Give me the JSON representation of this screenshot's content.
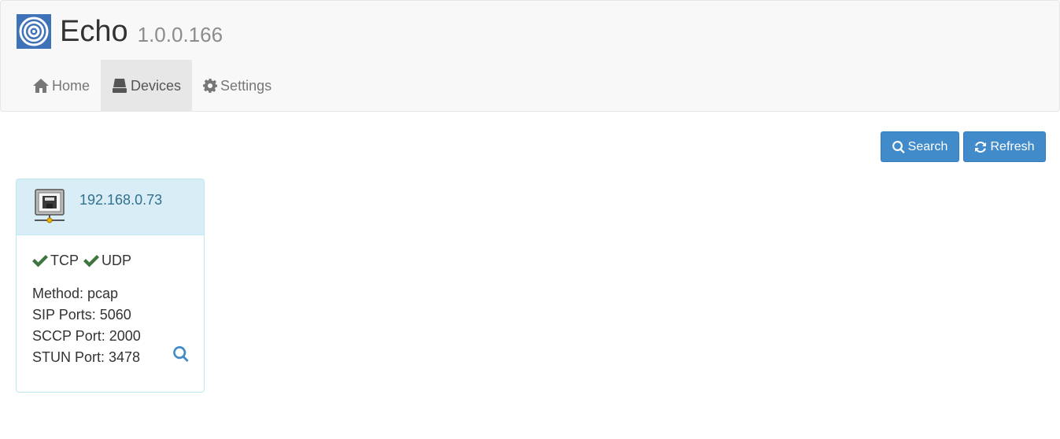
{
  "app": {
    "title": "Echo",
    "version": "1.0.0.166",
    "logo_icon": "concentric-circles-logo",
    "logo_color": "#3f73b8"
  },
  "nav": {
    "items": [
      {
        "label": "Home",
        "icon": "home-icon"
      },
      {
        "label": "Devices",
        "icon": "drive-icon",
        "active": true
      },
      {
        "label": "Settings",
        "icon": "gear-icon"
      }
    ]
  },
  "toolbar": {
    "search_label": "Search",
    "refresh_label": "Refresh",
    "button_color": "#428bca"
  },
  "device": {
    "ip": "192.168.0.73",
    "icon": "network-device-icon",
    "protocols": [
      "TCP",
      "UDP"
    ],
    "method": "Method: pcap",
    "sip_ports": "SIP Ports: 5060",
    "sccp_port": "SCCP Port: 2000",
    "stun_port": "STUN Port: 3478",
    "header_color": "#d9edf7",
    "check_color": "#3c763d"
  }
}
